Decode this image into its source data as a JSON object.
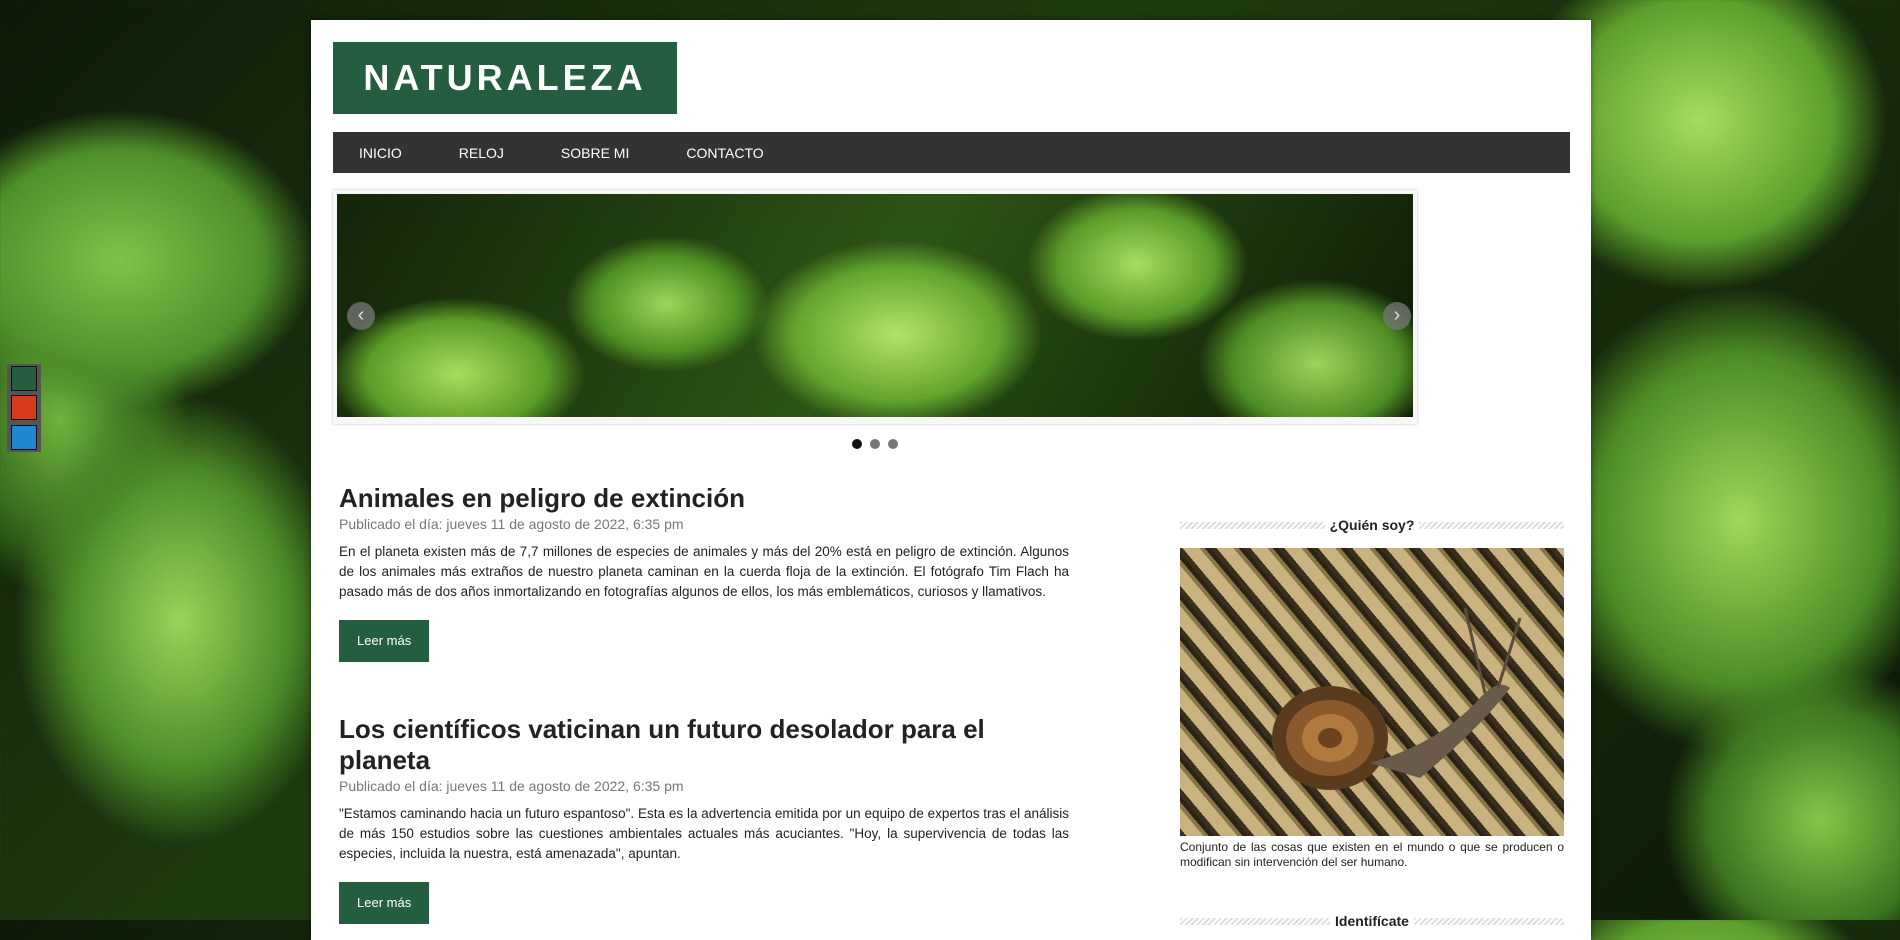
{
  "site": {
    "logo": "NATURALEZA"
  },
  "nav": {
    "items": [
      "INICIO",
      "RELOJ",
      "SOBRE MI",
      "CONTACTO"
    ]
  },
  "slider": {
    "prev": "‹",
    "next": "›",
    "dots": 3,
    "active": 0
  },
  "posts": [
    {
      "title": "Animales en peligro de extinción",
      "meta": "Publicado el día: jueves 11 de agosto de 2022, 6:35 pm",
      "body": "En el planeta existen más de 7,7 millones de especies de animales y más del 20% está en peligro de extinción. Algunos de los animales más extraños de nuestro planeta caminan en la cuerda floja de la extinción. El fotógrafo Tim Flach ha pasado más de dos años inmortalizando en fotografías algunos de ellos, los más emblemáticos, curiosos y llamativos.",
      "button": "Leer más"
    },
    {
      "title": "Los científicos vaticinan un futuro desolador para el planeta",
      "meta": "Publicado el día: jueves 11 de agosto de 2022, 6:35 pm",
      "body": "\"Estamos caminando hacia un futuro espantoso\". Esta es la advertencia emitida por un equipo de expertos tras el análisis de más 150 estudios sobre las cuestiones ambientales actuales más acuciantes. \"Hoy, la supervivencia de todas las especies, incluida la nuestra, está amenazada\", apuntan.",
      "button": "Leer más"
    }
  ],
  "sidebar": {
    "who_title": "¿Quién soy?",
    "who_text": "Conjunto de las cosas que existen en el mundo o que se producen o modifican sin intervención del ser humano.",
    "login_title": "Identifícate"
  },
  "colors": {
    "brand": "#245d3f",
    "nav": "#333333",
    "swatches": [
      "#245d3f",
      "#d63b1a",
      "#1e88d0"
    ]
  }
}
